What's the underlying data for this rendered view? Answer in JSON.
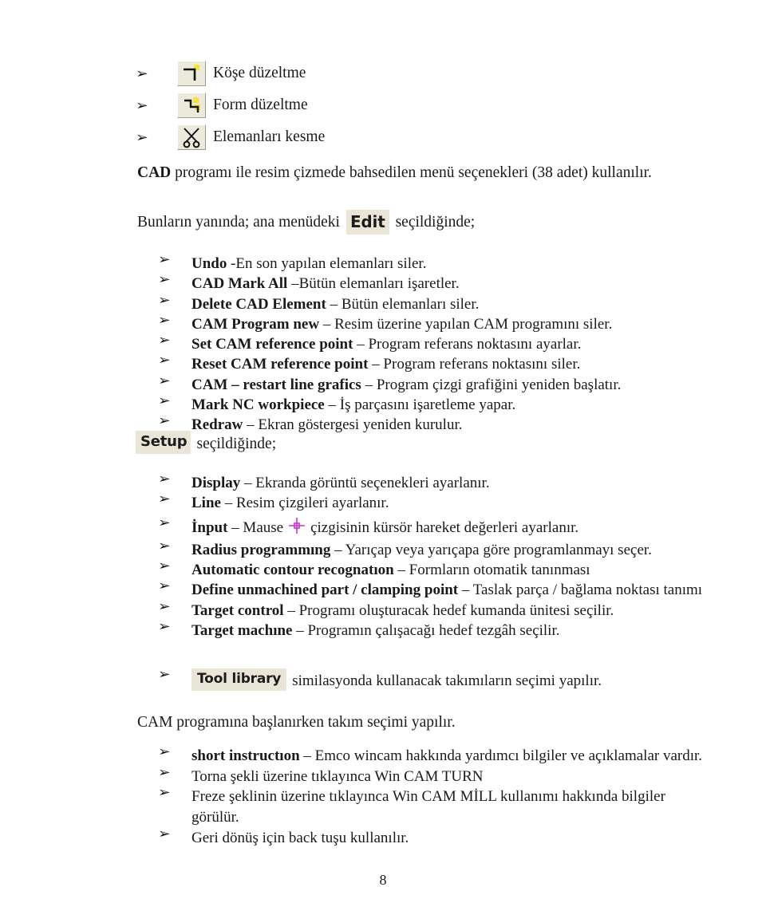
{
  "page": {
    "number": "8",
    "language": "tr"
  },
  "top_icon_items": [
    {
      "bullet": "➢",
      "icon": "corner-trim-icon",
      "label": "Köşe düzeltme"
    },
    {
      "bullet": "➢",
      "icon": "form-trim-icon",
      "label": "Form düzeltme"
    },
    {
      "bullet": "➢",
      "icon": "scissors-cut-elements-icon",
      "label": "Elemanları kesme"
    }
  ],
  "cad_paragraph": {
    "bold_lead": "CAD",
    "rest": " programı ile resim çizmede bahsedilen menü seçenekleri (38 adet) kullanılır."
  },
  "intro_paragraph": {
    "before": "Bunların yanında; ana menüdeki",
    "button_label": "Edit",
    "after": "seçildiğinde;"
  },
  "edit_menu_items": [
    {
      "bullet": "➢",
      "term": "Undo",
      "desc": " -En son yapılan elemanları siler."
    },
    {
      "bullet": "➢",
      "term": "CAD Mark All",
      "desc": " –Bütün elemanları işaretler."
    },
    {
      "bullet": "➢",
      "term": "Delete CAD Element",
      "desc": " – Bütün elemanları siler."
    },
    {
      "bullet": "➢",
      "term": "CAM Program new",
      "desc": " – Resim üzerine yapılan CAM programını siler."
    },
    {
      "bullet": "➢",
      "term": "Set CAM reference point",
      "desc": " – Program referans noktasını ayarlar."
    },
    {
      "bullet": "➢",
      "term": "Reset CAM reference point",
      "desc": " – Program referans noktasını siler."
    },
    {
      "bullet": "➢",
      "term": "CAM – restart line grafics",
      "desc": " – Program çizgi grafiğini yeniden başlatır."
    },
    {
      "bullet": "➢",
      "term": "Mark NC workpiece",
      "desc": " – İş parçasını işaretleme yapar."
    },
    {
      "bullet": "➢",
      "term": "Redraw",
      "desc": " – Ekran göstergesi yeniden kurulur."
    }
  ],
  "setup_heading": {
    "button_label": "Setup",
    "after": "seçildiğinde;"
  },
  "setup_items": [
    {
      "bullet": "➢",
      "term": "Display",
      "desc": " – Ekranda görüntü seçenekleri ayarlanır.",
      "icon": null
    },
    {
      "bullet": "➢",
      "term": "Line",
      "desc": " – Resim çizgileri ayarlanır.",
      "icon": null
    },
    {
      "bullet": "➢",
      "term": "İnput",
      "desc": " – Mause",
      "icon": "crosshair-cursor-icon",
      "desc2": "çizgisinin kürsör hareket değerleri ayarlanır."
    },
    {
      "bullet": "➢",
      "term": "Radius programmıng",
      "desc": " – Yarıçap veya yarıçapa göre programlanmayı seçer.",
      "icon": null
    },
    {
      "bullet": "➢",
      "term": "Automatic contour recognatıon",
      "desc": " – Formların otomatik tanınması",
      "icon": null
    },
    {
      "bullet": "➢",
      "term": "Define unmachined part / clamping point",
      "desc": " – Taslak parça / bağlama noktası tanımı",
      "icon": null
    },
    {
      "bullet": "➢",
      "term": "Target control",
      "desc": " – Programı oluşturacak hedef kumanda ünitesi seçilir.",
      "icon": null
    },
    {
      "bullet": "➢",
      "term": "Target machıne",
      "desc": " – Programın çalışacağı hedef tezgâh seçilir.",
      "icon": null
    }
  ],
  "tool_library_row": {
    "bullet": "➢",
    "button_label": "Tool library",
    "after": "similasyonda kullanacak takımıların seçimi yapılır."
  },
  "cam_paragraph": "CAM programına başlanırken takım seçimi yapılır.",
  "bottom_items": [
    {
      "bullet": "➢",
      "term": "short instructıon",
      "desc": " – Emco wincam hakkında yardımcı bilgiler ve açıklamalar vardır."
    },
    {
      "bullet": "➢",
      "term": "",
      "desc": "Torna şekli üzerine tıklayınca Win CAM TURN"
    },
    {
      "bullet": "➢",
      "term": "",
      "desc": "Freze şeklinin üzerine tıklayınca Win CAM MİLL kullanımı hakkında bilgiler görülür."
    },
    {
      "bullet": "➢",
      "term": "",
      "desc": "Geri dönüş için back tuşu kullanılır."
    }
  ],
  "colors": {
    "button_face": "#e9e6d7",
    "icon_highlight": "#f2e23a",
    "crosshair": "#cc33cc",
    "text": "#1a1a1a"
  }
}
